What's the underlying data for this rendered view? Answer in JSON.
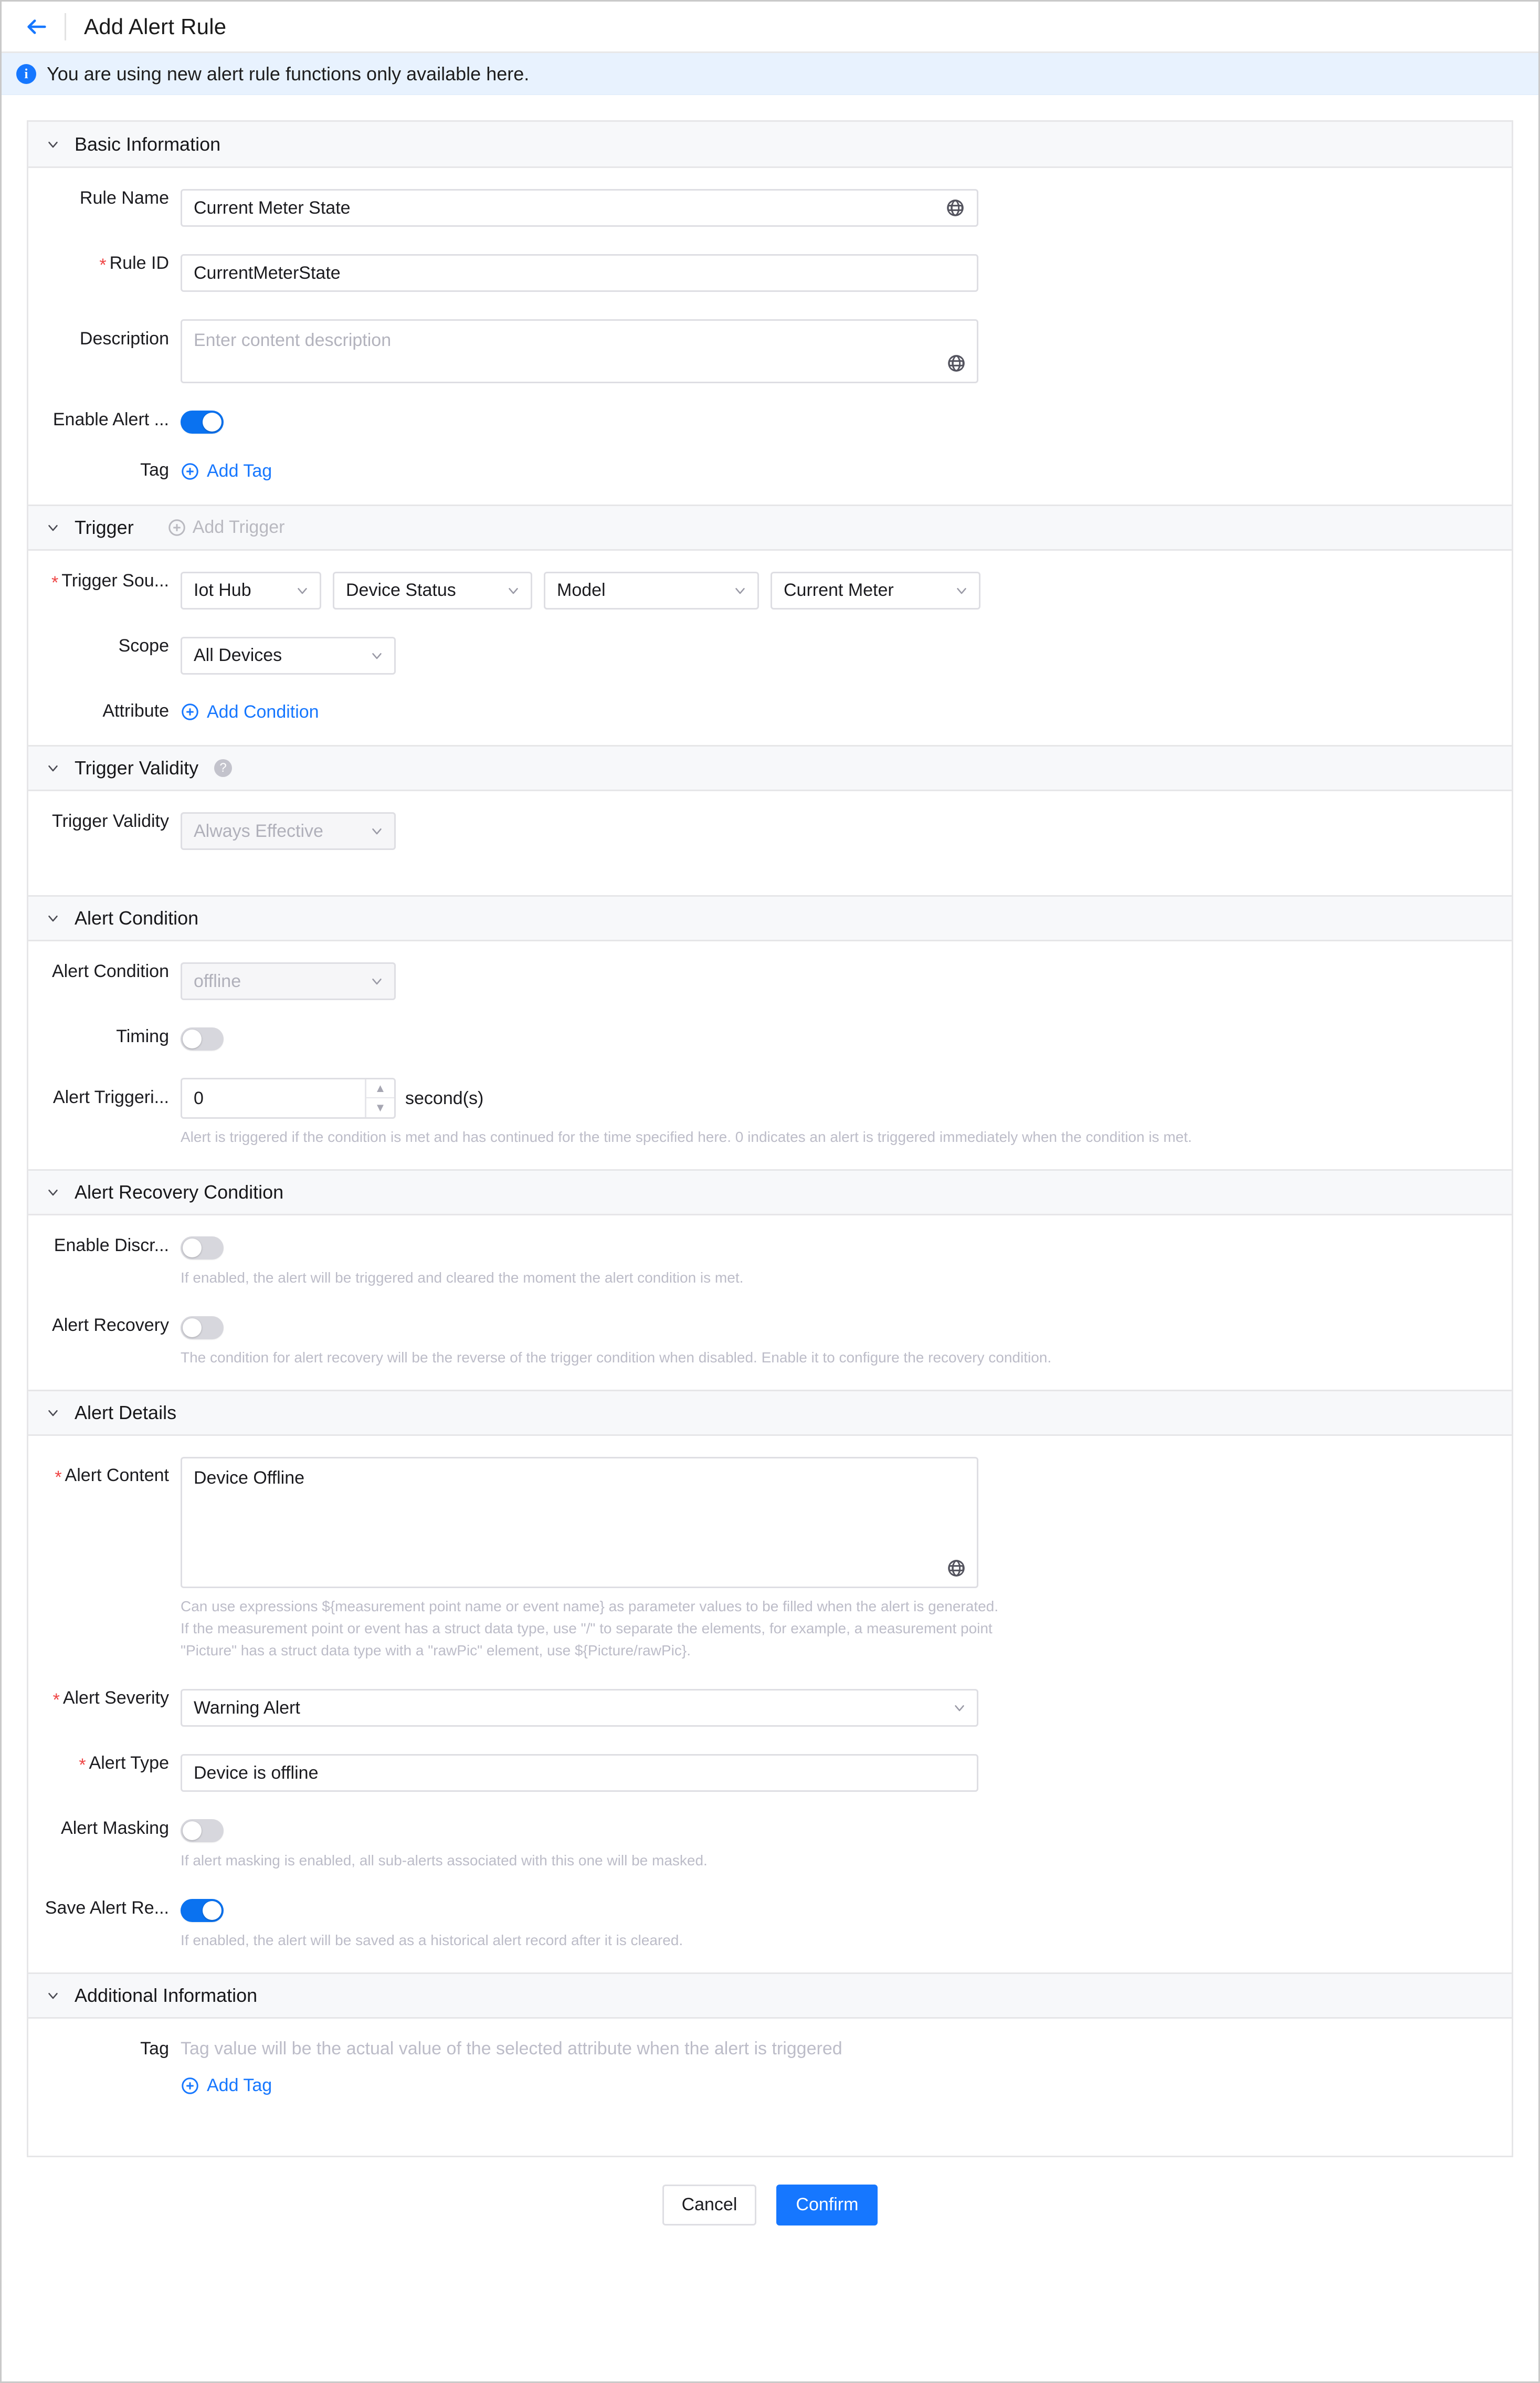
{
  "header": {
    "title": "Add Alert Rule",
    "back_icon": "back-arrow-icon"
  },
  "banner": {
    "icon": "info-icon",
    "text": "You are using new alert rule functions only available here."
  },
  "colors": {
    "accent": "#1677ff",
    "toggle_on": "#0a72f0",
    "required_star": "#ef4444",
    "banner_bg": "#e8f2fe",
    "section_header_bg": "#f7f8fa"
  },
  "sections": {
    "basic_information": {
      "title": "Basic Information",
      "rule_name": {
        "label": "Rule Name",
        "value": "Current Meter State",
        "icon": "globe-icon"
      },
      "rule_id": {
        "label": "Rule ID",
        "value": "CurrentMeterState",
        "required": "*"
      },
      "description": {
        "label": "Description",
        "placeholder": "Enter content description",
        "icon": "globe-icon"
      },
      "enable_alert": {
        "label": "Enable Alert ...",
        "state": "on"
      },
      "tag": {
        "label": "Tag",
        "add_label": "Add Tag",
        "icon": "plus-circle-icon"
      }
    },
    "trigger": {
      "title": "Trigger",
      "add_trigger": {
        "label": "Add Trigger",
        "icon": "plus-circle-icon"
      },
      "trigger_source": {
        "label": "Trigger Sou...",
        "required": "*",
        "selects": [
          "Iot Hub",
          "Device Status",
          "Model",
          "Current Meter"
        ]
      },
      "scope": {
        "label": "Scope",
        "value": "All Devices"
      },
      "attribute": {
        "label": "Attribute",
        "add_label": "Add Condition",
        "icon": "plus-circle-icon"
      }
    },
    "trigger_validity": {
      "title": "Trigger Validity",
      "help_icon": "question-mark-icon",
      "field": {
        "label": "Trigger Validity",
        "value": "Always Effective",
        "disabled": true
      }
    },
    "alert_condition": {
      "title": "Alert Condition",
      "condition": {
        "label": "Alert Condition",
        "value": "offline",
        "disabled": true
      },
      "timing": {
        "label": "Timing",
        "state": "off"
      },
      "alert_triggering": {
        "label": "Alert Triggeri...",
        "value": "0",
        "unit": "second(s)",
        "hint": "Alert is triggered if the condition is met and has continued for the time specified here. 0 indicates an alert is triggered immediately when the condition is met."
      }
    },
    "alert_recovery_condition": {
      "title": "Alert Recovery Condition",
      "enable_discrete": {
        "label": "Enable Discr...",
        "state": "off",
        "hint": "If enabled, the alert will be triggered and cleared the moment the alert condition is met."
      },
      "alert_recovery": {
        "label": "Alert Recovery",
        "state": "off",
        "hint": "The condition for alert recovery will be the reverse of the trigger condition when disabled. Enable it to configure the recovery condition."
      }
    },
    "alert_details": {
      "title": "Alert Details",
      "alert_content": {
        "label": "Alert Content",
        "required": "*",
        "value": "Device Offline",
        "icon": "globe-icon",
        "hint_line1": "Can use expressions ${measurement point name or event name} as parameter values to be filled when the alert is generated.",
        "hint_line2": "If the measurement point or event has a struct data type, use \"/\" to separate the elements, for example, a measurement point",
        "hint_line3": "\"Picture\" has a struct data type with a \"rawPic\" element, use ${Picture/rawPic}."
      },
      "alert_severity": {
        "label": "Alert Severity",
        "required": "*",
        "value": "Warning Alert"
      },
      "alert_type": {
        "label": "Alert Type",
        "required": "*",
        "value": "Device is offline"
      },
      "alert_masking": {
        "label": "Alert Masking",
        "state": "off",
        "hint": "If alert masking is enabled, all sub-alerts associated with this one will be masked."
      },
      "save_alert_record": {
        "label": "Save Alert Re...",
        "state": "on",
        "hint": "If enabled, the alert will be saved as a historical alert record after it is cleared."
      }
    },
    "additional_information": {
      "title": "Additional Information",
      "tag": {
        "label": "Tag",
        "note": "Tag value will be the actual value of the selected attribute when the alert is triggered",
        "add_label": "Add Tag",
        "icon": "plus-circle-icon"
      }
    }
  },
  "footer": {
    "cancel": "Cancel",
    "confirm": "Confirm"
  }
}
